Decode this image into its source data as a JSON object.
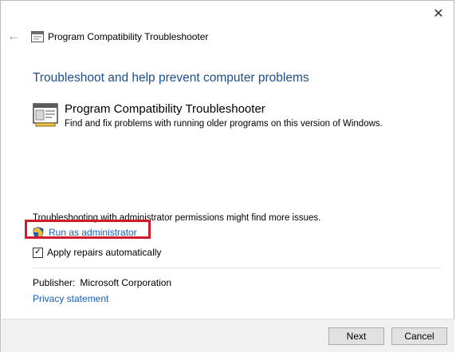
{
  "window": {
    "close_glyph": "✕",
    "back_glyph": "←",
    "title": "Program Compatibility Troubleshooter"
  },
  "main": {
    "heading": "Troubleshoot and help prevent computer problems",
    "tool": {
      "title": "Program Compatibility Troubleshooter",
      "description": "Find and fix problems with running older programs on this version of Windows.",
      "icon": "troubleshooter-icon"
    },
    "admin_note": "Troubleshooting with administrator permissions might find more issues.",
    "run_as_admin": {
      "label": "Run as administrator",
      "icon": "uac-shield-icon"
    },
    "apply_repairs": {
      "label": "Apply repairs automatically",
      "checked": true,
      "check_glyph": "✓"
    },
    "publisher": {
      "label": "Publisher:",
      "value": "Microsoft Corporation"
    },
    "privacy_link": "Privacy statement"
  },
  "footer": {
    "next_label": "Next",
    "cancel_label": "Cancel"
  },
  "colors": {
    "heading": "#1e4e8c",
    "link": "#1a5fb4",
    "highlight": "#d11a2a"
  }
}
